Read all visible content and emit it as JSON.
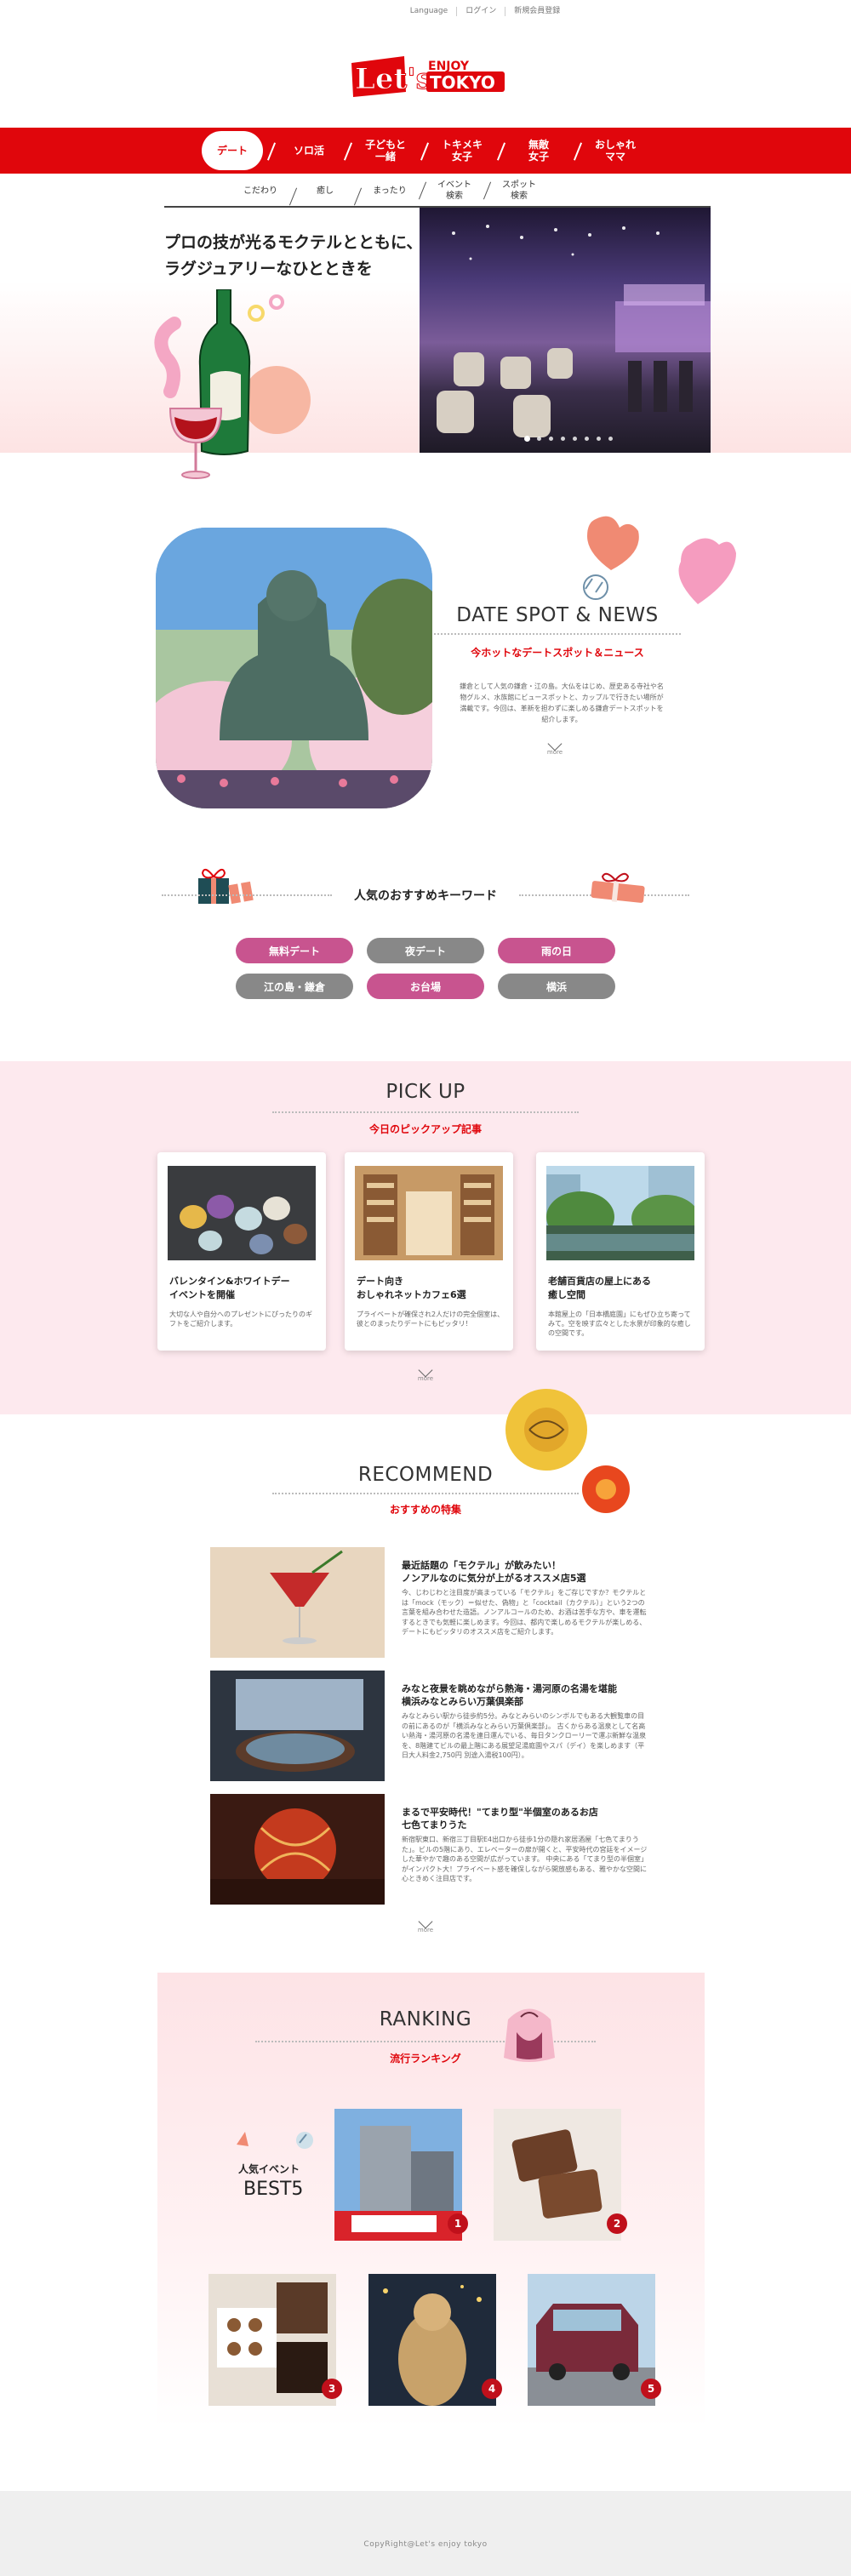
{
  "util_nav": [
    "Language",
    "ログイン",
    "新規会員登録"
  ],
  "logo": {
    "main": "Let's",
    "enjoy": "ENJOY",
    "tokyo": "TOKYO"
  },
  "main_nav": [
    {
      "label": "デート",
      "active": true
    },
    {
      "label": "ソロ活"
    },
    {
      "label": "子どもと\n一緒"
    },
    {
      "label": "トキメキ\n女子"
    },
    {
      "label": "無敵\n女子"
    },
    {
      "label": "おしゃれ\nママ"
    }
  ],
  "sub_nav": [
    "こだわり",
    "癒し",
    "まったり",
    "イベント\n検索",
    "スポット\n検索"
  ],
  "hero": {
    "title": "プロの技が光るモクテルとともに、ラグジュアリーなひとときを",
    "dot_count": 8
  },
  "date_spot": {
    "heading": "DATE SPOT & NEWS",
    "subheading": "今ホットなデートスポット＆ニュース",
    "desc": "鎌倉として人気の鎌倉・江の島。大仏をはじめ、歴史ある寺社や名物グルメ、水族館にビュースポットと、カップルで行きたい場所が満載です。今回は、革新を担わずに楽しめる鎌倉デートスポットを紹介します。",
    "more": "more"
  },
  "keywords": {
    "title": "人気のおすすめキーワード",
    "items": [
      {
        "label": "無料デート",
        "color": "pink"
      },
      {
        "label": "夜デート",
        "color": "gray"
      },
      {
        "label": "雨の日",
        "color": "pink"
      },
      {
        "label": "江の島・鎌倉",
        "color": "gray"
      },
      {
        "label": "お台場",
        "color": "pink"
      },
      {
        "label": "横浜",
        "color": "gray"
      }
    ]
  },
  "pickup": {
    "heading": "PICK UP",
    "subheading": "今日のピックアップ記事",
    "cards": [
      {
        "title": "バレンタイン&ホワイトデー\nイベントを開催",
        "text": "大切な人や自分へのプレゼントにぴったりのギフトをご紹介します。"
      },
      {
        "title": "デート向き\nおしゃれネットカフェ6選",
        "text": "プライベートが確保され2人だけの完全個室は、彼とのまったりデートにもピッタリ！"
      },
      {
        "title": "老舗百貨店の屋上にある\n癒し空間",
        "text": "本館屋上の「日本橋庭園」にもぜひ立ち寄ってみて。空を映す広々とした水景が印象的な癒しの空間です。"
      }
    ],
    "more": "more"
  },
  "recommend": {
    "heading": "RECOMMEND",
    "subheading": "おすすめの特集",
    "items": [
      {
        "title": "最近話題の「モクテル」が飲みたい！\nノンアルなのに気分が上がるオススメ店5選",
        "text": "今、じわじわと注目度が高まっている「モクテル」をご存じですか？モクテルとは「mock（モック）＝似せた、偽物」と「cocktail（カクテル）」という2つの言葉を組み合わせた造語。ノンアルコールのため、お酒は苦手な方や、車を運転するときでも気軽に楽しめます。今回は、都内で楽しめるモクテルが楽しめる、デートにもピッタリのオススメ店をご紹介します。"
      },
      {
        "title": "みなと夜景を眺めながら熱海・湯河原の名湯を堪能\n横浜みなとみらい万葉倶楽部",
        "text": "みなとみらい駅から徒歩約5分。みなとみらいのシンボルでもある大観覧車の目の前にあるのが「横浜みなとみらい万葉倶楽部」。\n古くからある温泉として名高い熱海・湯河原の名湯を連日運んでいる、毎日タンクローリーで運ぶ新鮮な温泉を、8階建てビルの最上階にある展望足湯庭園やスパ（デイ）を楽しめます（平日大人料金2,750円 別途入湯税100円）。"
      },
      {
        "title": "まるで平安時代！\"てまり型\"半個室のあるお店\n七色てまりうた",
        "text": "新宿駅東口、新宿三丁目駅E4出口から徒歩1分の隠れ家居酒屋「七色てまりうた」。ビルの5階にあり、エレベーターの扉が開くと、平安時代の宮廷をイメージした華やかで趣のある空間が広がっています。\n中央にある「てまり型の半個室」がインパクト大！プライベート感を確保しながら開放感もある、雅やかな空間に心ときめく注目店です。"
      }
    ],
    "more": "more"
  },
  "ranking": {
    "heading": "RANKING",
    "subheading": "流行ランキング",
    "best5_label": "人気イベント",
    "best5_big": "BEST5",
    "ranks": [
      "1",
      "2",
      "3",
      "4",
      "5"
    ]
  },
  "footer": {
    "copyright": "CopyRight@Let's enjoy tokyo"
  },
  "colors": {
    "brand_red": "#e0060c",
    "keyword_pink": "#c8548f",
    "keyword_gray": "#888888",
    "pickup_bg": "#fde9ee"
  }
}
